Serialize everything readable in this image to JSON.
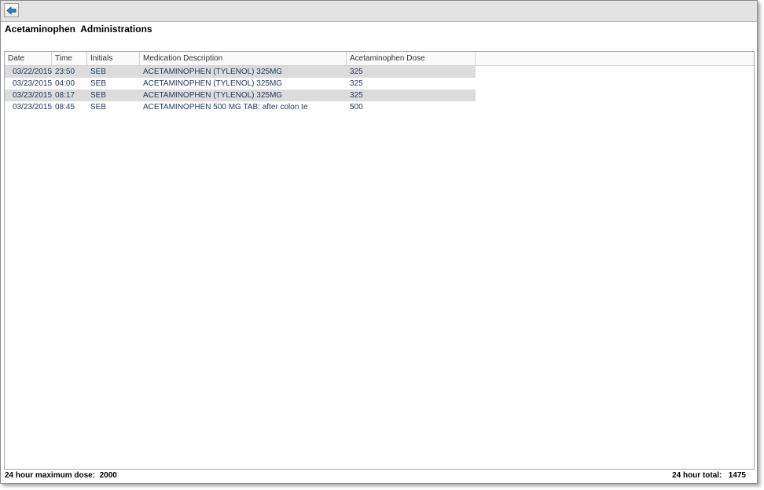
{
  "toolbar": {
    "back_icon": "back-arrow-icon"
  },
  "page": {
    "title": "Acetaminophen  Administrations"
  },
  "table": {
    "columns": [
      "Date",
      "Time",
      "Initials",
      "Medication Description",
      "Acetaminophen Dose"
    ],
    "rows": [
      {
        "date": "03/22/2015",
        "time": "23:50",
        "initials": "SEB",
        "description": "ACETAMINOPHEN (TYLENOL)  325MG",
        "dose": "325"
      },
      {
        "date": "03/23/2015",
        "time": "04:00",
        "initials": "SEB",
        "description": "ACETAMINOPHEN (TYLENOL)  325MG",
        "dose": "325"
      },
      {
        "date": "03/23/2015",
        "time": "08:17",
        "initials": "SEB",
        "description": "ACETAMINOPHEN (TYLENOL)  325MG",
        "dose": "325"
      },
      {
        "date": "03/23/2015",
        "time": "08:45",
        "initials": "SEB",
        "description": "ACETAMINOPHEN 500 MG TAB: after colon te",
        "dose": "500"
      }
    ]
  },
  "footer": {
    "max_dose_label": "24 hour maximum dose:",
    "max_dose_value": "2000",
    "total_label": "24 hour total:",
    "total_value": "1475"
  },
  "colors": {
    "row_alt": "#dcdcdc",
    "cell_text": "#1f3c60",
    "toolbar_bg": "#e3e3e3",
    "back_arrow": "#2a7fd4"
  }
}
